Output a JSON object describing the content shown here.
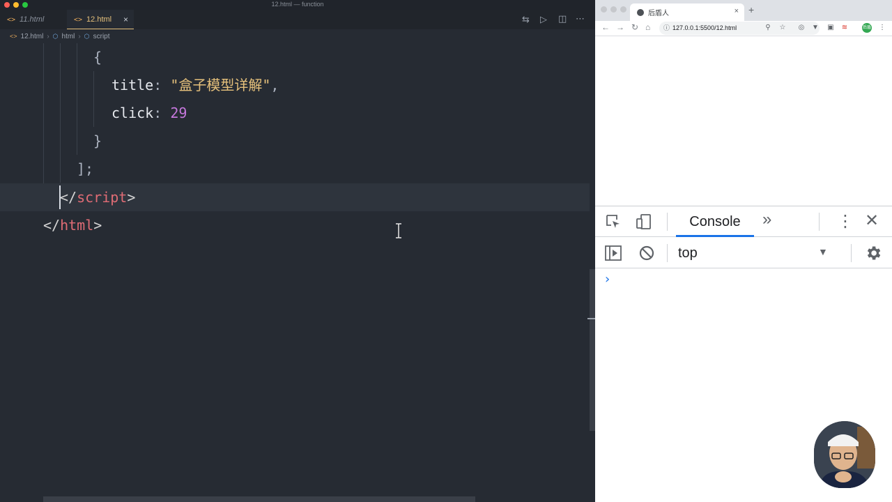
{
  "window": {
    "title": "12.html — function"
  },
  "editor": {
    "tabs": [
      {
        "label": "11.html",
        "active": false
      },
      {
        "label": "12.html",
        "active": true
      }
    ],
    "tab_close": "×",
    "breadcrumb": [
      "12.html",
      "html",
      "script"
    ],
    "code_lines": [
      {
        "parts": [
          [
            "{",
            "punct"
          ]
        ]
      },
      {
        "parts": [
          [
            "title",
            "key"
          ],
          [
            ": ",
            "punct"
          ],
          [
            "\"盒子模型详解\"",
            "str"
          ],
          [
            ",",
            "punct"
          ]
        ]
      },
      {
        "parts": [
          [
            "click",
            "key"
          ],
          [
            ": ",
            "punct"
          ],
          [
            "29",
            "num"
          ]
        ]
      },
      {
        "parts": [
          [
            "}",
            "punct"
          ]
        ]
      },
      {
        "parts": [
          [
            "];",
            "punct"
          ]
        ]
      },
      {
        "parts": [
          [
            "</",
            "bracket"
          ],
          [
            "script",
            "tag"
          ],
          [
            ">",
            "bracket"
          ]
        ]
      },
      {
        "parts": [
          [
            "</",
            "bracket"
          ],
          [
            "html",
            "tag"
          ],
          [
            ">",
            "bracket"
          ]
        ]
      }
    ],
    "colors": {
      "background": "#262b33",
      "string": "#e5c07b",
      "number": "#c678dd",
      "tag": "#e06c75"
    }
  },
  "browser": {
    "tab_title": "后盾人",
    "tab_close": "×",
    "new_tab": "+",
    "url": "127.0.0.1:5500/12.html",
    "extension_badge": "后盾"
  },
  "devtools": {
    "console_tab": "Console",
    "more_tabs": "»",
    "context": "top",
    "prompt": "›",
    "accent": "#1a73e8"
  }
}
